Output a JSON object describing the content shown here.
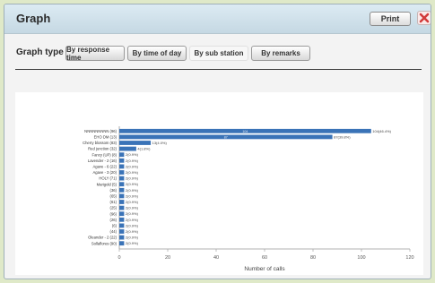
{
  "window": {
    "title": "Graph",
    "print_label": "Print"
  },
  "graph_type": {
    "label": "Graph type",
    "tabs": [
      {
        "label": "By response time",
        "active": false
      },
      {
        "label": "By time of day",
        "active": false
      },
      {
        "label": "By sub station",
        "active": true
      },
      {
        "label": "By remarks",
        "active": false
      }
    ]
  },
  "colors": {
    "bar": "#3a73b7",
    "close": "#d23b3b"
  },
  "chart_data": {
    "type": "bar",
    "orientation": "horizontal",
    "xlabel": "Number of calls",
    "xlim": [
      0,
      120
    ],
    "xticks": [
      0,
      20,
      40,
      60,
      80,
      100,
      120
    ],
    "categories": [
      "NNNNNNNNN (96)",
      "EHO DM (13)",
      "Cherry blossom (83)",
      "Red junction (32)",
      "Fancy (UP) (8)",
      "Lavender - 2 (16)",
      "Agave - 6 (22)",
      "Agave - 3 (20)",
      "HOLY (71)",
      "Marigold (5)",
      "(36)",
      "(65)",
      "(61)",
      "(25)",
      "(96)",
      "(26)",
      "(6)",
      "(44)",
      "Oleander - 2 (22)",
      "Sollaflores (90)"
    ],
    "values": [
      104,
      88,
      13,
      7,
      2,
      2,
      2,
      2,
      2,
      2,
      2,
      2,
      2,
      2,
      2,
      2,
      2,
      2,
      2,
      2
    ],
    "value_labels": [
      "104(46.4%)",
      "87(39.8%)",
      "13(4.0%)",
      "4(1.8%)",
      "2(0.9%)",
      "2(0.9%)",
      "2(0.9%)",
      "2(0.9%)",
      "2(0.9%)",
      "2(0.9%)",
      "2(0.9%)",
      "2(0.9%)",
      "2(0.9%)",
      "2(0.9%)",
      "2(0.9%)",
      "2(0.9%)",
      "2(0.9%)",
      "2(0.9%)",
      "2(0.9%)",
      "2(0.9%)"
    ],
    "inner_labels": [
      "104",
      "87"
    ],
    "grid": false
  }
}
